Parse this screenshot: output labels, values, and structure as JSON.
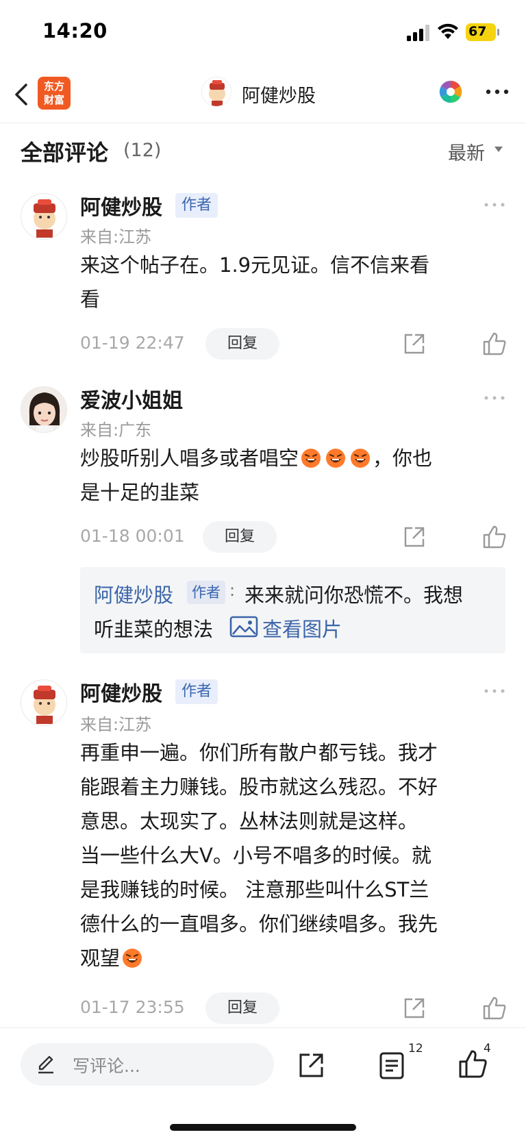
{
  "status_bar": {
    "time": "14:20",
    "battery": "67"
  },
  "nav": {
    "app_logo_line1": "东方",
    "app_logo_line2": "财富",
    "title": "阿健炒股",
    "icons": [
      "back-icon",
      "camera-icon",
      "more-icon"
    ]
  },
  "comments_header": {
    "title": "全部评论",
    "count": "(12)",
    "sort": "最新"
  },
  "comments": [
    {
      "username": "阿健炒股",
      "badge": "作者",
      "location": "来自:江苏",
      "text_line1": "来这个帖子在。1.9元见证。信不信来看",
      "text_line2": "看",
      "time": "01-19 22:47",
      "reply_label": "回复"
    },
    {
      "username": "爱波小姐姐",
      "location": "来自:广东",
      "text_line1_a": "炒股听别人唱多或者唱空",
      "text_line1_b": "，你也",
      "text_line2": "是十足的韭菜",
      "time": "01-18 00:01",
      "reply_label": "回复",
      "reply": {
        "name": "阿健炒股",
        "badge": "作者",
        "colon": ":",
        "text_line1": "来来就问你恐慌不。我想",
        "text_line2": "听韭菜的想法",
        "view_image": "查看图片"
      }
    },
    {
      "username": "阿健炒股",
      "badge": "作者",
      "location": "来自:江苏",
      "lines": [
        "再重申一遍。你们所有散户都亏钱。我才",
        "能跟着主力赚钱。股市就这么残忍。不好",
        "意思。太现实了。丛林法则就是这样。",
        "当一些什么大V。小号不唱多的时候。就",
        "是我赚钱的时候。 注意那些叫什么ST兰",
        "德什么的一直唱多。你们继续唱多。我先"
      ],
      "last_line": "观望",
      "time": "01-17 23:55",
      "reply_label": "回复"
    }
  ],
  "bottom_bar": {
    "input_placeholder": "写评论...",
    "comment_count": "12",
    "like_count": "4"
  },
  "colors": {
    "accent_blue": "#3a64a8",
    "logo_orange": "#f05a22",
    "battery_yellow": "#f5d40f"
  }
}
